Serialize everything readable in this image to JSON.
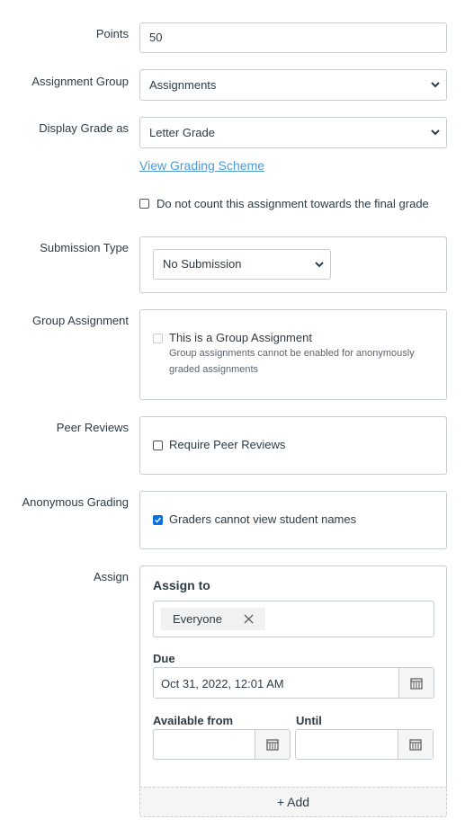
{
  "points": {
    "label": "Points",
    "value": "50"
  },
  "assignment_group": {
    "label": "Assignment Group",
    "value": "Assignments"
  },
  "display_grade": {
    "label": "Display Grade as",
    "value": "Letter Grade",
    "link": "View Grading Scheme"
  },
  "final_grade_checkbox": {
    "label": "Do not count this assignment towards the final grade",
    "checked": false
  },
  "submission_type": {
    "label": "Submission Type",
    "value": "No Submission"
  },
  "group_assignment": {
    "label": "Group Assignment",
    "checkbox_label": "This is a Group Assignment",
    "note": "Group assignments cannot be enabled for anonymously graded assignments",
    "checked": false,
    "disabled": true
  },
  "peer_reviews": {
    "label": "Peer Reviews",
    "checkbox_label": "Require Peer Reviews",
    "checked": false
  },
  "anonymous_grading": {
    "label": "Anonymous Grading",
    "checkbox_label": "Graders cannot view student names",
    "checked": true
  },
  "assign": {
    "label": "Assign",
    "assign_to_label": "Assign to",
    "token": "Everyone",
    "due_label": "Due",
    "due_value": "Oct 31, 2022, 12:01 AM",
    "available_from_label": "Available from",
    "until_label": "Until",
    "add_label": "+ Add"
  },
  "colors": {
    "accent": "#0770e3",
    "link": "#4d9bd6",
    "border": "#c7cdd1"
  }
}
